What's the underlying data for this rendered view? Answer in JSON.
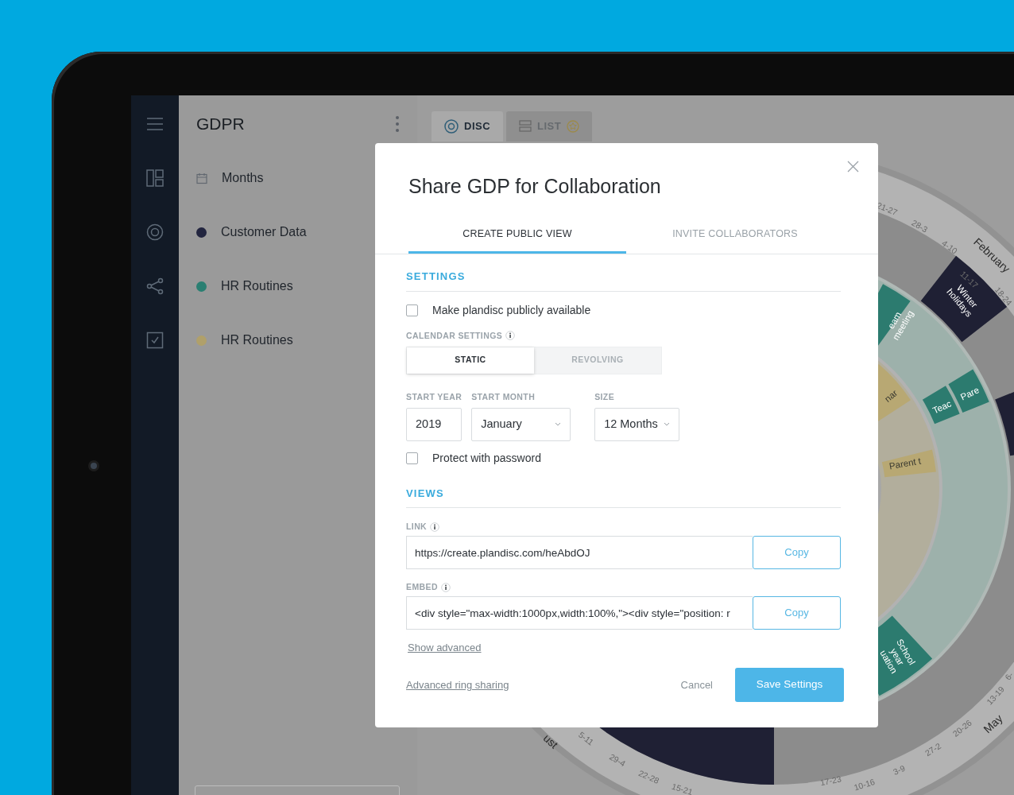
{
  "panel": {
    "title": "GDPR",
    "items": [
      {
        "label": "Months",
        "kind": "calendar"
      },
      {
        "label": "Customer Data",
        "kind": "dot",
        "color": "#22253f"
      },
      {
        "label": "HR Routines",
        "kind": "dot",
        "color": "#2a7f72"
      },
      {
        "label": "HR Routines",
        "kind": "dot",
        "color": "#b0a06a"
      }
    ]
  },
  "view_tabs": [
    {
      "label": "DISC",
      "kind": "disc",
      "selected": true
    },
    {
      "label": "LIST",
      "kind": "list",
      "selected": false
    }
  ],
  "disc": {
    "labels": [
      {
        "kind": "week",
        "lines": [
          "21-27"
        ]
      },
      {
        "kind": "week",
        "lines": [
          "28-3"
        ]
      },
      {
        "kind": "week",
        "lines": [
          "4-10"
        ]
      },
      {
        "kind": "month",
        "lines": [
          "February"
        ]
      },
      {
        "kind": "week",
        "lines": [
          "11-17"
        ]
      },
      {
        "kind": "week",
        "lines": [
          "18-24"
        ]
      },
      {
        "kind": "event",
        "lines": [
          "Winter",
          "holidays"
        ]
      },
      {
        "kind": "event",
        "lines": [
          "eam",
          "meeting"
        ]
      },
      {
        "kind": "event",
        "lines": [
          "nar"
        ]
      },
      {
        "kind": "event",
        "lines": [
          "Teac"
        ]
      },
      {
        "kind": "event",
        "lines": [
          "Pare"
        ]
      },
      {
        "kind": "event",
        "lines": [
          "Parent t"
        ]
      },
      {
        "kind": "event",
        "lines": [
          "School",
          "year",
          "uation"
        ]
      },
      {
        "kind": "month",
        "lines": [
          "ust"
        ]
      },
      {
        "kind": "week",
        "lines": [
          "5-11"
        ]
      },
      {
        "kind": "week",
        "lines": [
          "29-4"
        ]
      },
      {
        "kind": "week",
        "lines": [
          "22-28"
        ]
      },
      {
        "kind": "week",
        "lines": [
          "15-21"
        ]
      },
      {
        "kind": "week",
        "lines": [
          "17-23"
        ]
      },
      {
        "kind": "week",
        "lines": [
          "10-16"
        ]
      },
      {
        "kind": "week",
        "lines": [
          "3-9"
        ]
      },
      {
        "kind": "week",
        "lines": [
          "27-2"
        ]
      },
      {
        "kind": "week",
        "lines": [
          "20-26"
        ]
      },
      {
        "kind": "week",
        "lines": [
          "13-19"
        ]
      },
      {
        "kind": "month",
        "lines": [
          "May"
        ]
      },
      {
        "kind": "week",
        "lines": [
          "6-"
        ]
      }
    ]
  },
  "dialog": {
    "title": "Share GDP for Collaboration",
    "tabs": [
      {
        "label": "CREATE PUBLIC VIEW",
        "selected": true
      },
      {
        "label": "INVITE COLLABORATORS",
        "selected": false
      }
    ],
    "settings": {
      "heading": "SETTINGS",
      "public_checkbox": {
        "label": "Make plandisc publicly available",
        "checked": false
      },
      "calendar_label": "CALENDAR SETTINGS",
      "modes": [
        {
          "label": "STATIC",
          "selected": true
        },
        {
          "label": "REVOLVING",
          "selected": false
        }
      ],
      "fields": [
        {
          "label": "START YEAR",
          "kind": "input",
          "value": "2019"
        },
        {
          "label": "START MONTH",
          "kind": "select",
          "value": "January"
        },
        {
          "label": "SIZE",
          "kind": "select",
          "value": "12 Months"
        }
      ],
      "password_checkbox": {
        "label": "Protect with password",
        "checked": false
      }
    },
    "views": {
      "heading": "VIEWS",
      "rows": [
        {
          "label": "LINK",
          "value": "https://create.plandisc.com/heAbdOJ",
          "button": "Copy"
        },
        {
          "label": "EMBED",
          "value": "<div style=\"max-width:1000px,width:100%,\"><div style=\"position: r",
          "button": "Copy"
        }
      ],
      "show_advanced": "Show advanced"
    },
    "footer": {
      "link": "Advanced ring sharing",
      "cancel": "Cancel",
      "save": "Save Settings"
    }
  }
}
